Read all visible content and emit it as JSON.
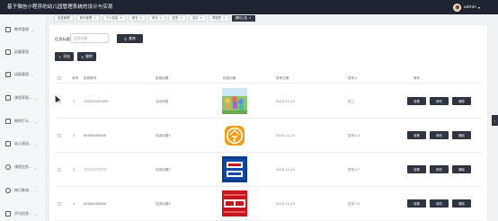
{
  "app": {
    "title": "基于微信小程序的幼儿园管理系统的设计与实现",
    "user_name": "admin"
  },
  "sidebar": {
    "items": [
      {
        "label": "教师管理",
        "icon": "teacher-icon"
      },
      {
        "label": "幼童管理",
        "icon": "child-icon"
      },
      {
        "label": "班级管理",
        "icon": "class-icon"
      },
      {
        "label": "课程表管...",
        "icon": "schedule-icon"
      },
      {
        "label": "教师打卡...",
        "icon": "clock-in-icon"
      },
      {
        "label": "幼儿接送...",
        "icon": "pickup-icon"
      },
      {
        "label": "课程信息...",
        "icon": "course-icon"
      },
      {
        "label": "每日食谱...",
        "icon": "menu-icon"
      },
      {
        "label": "资讯信息...",
        "icon": "news-icon"
      }
    ]
  },
  "tabs": [
    {
      "label": "信息管理"
    },
    {
      "label": "家长管理"
    },
    {
      "label": "个人信息"
    },
    {
      "label": "家长"
    },
    {
      "label": "家长"
    },
    {
      "label": "反馈"
    },
    {
      "label": "活动"
    },
    {
      "label": "课程表"
    },
    {
      "label": "通知公告",
      "active": true
    }
  ],
  "search": {
    "label": "信息标题",
    "placeholder": "信息标题",
    "button_label": "查询"
  },
  "toolbar": {
    "add_label": "添加",
    "delete_label": "删除"
  },
  "table": {
    "columns": {
      "index": "序号",
      "account": "信息账号",
      "title": "信息标题",
      "image": "信息封面",
      "date": "发布日期",
      "publisher": "发布人"
    },
    "operations_header": "操作",
    "rows": [
      {
        "index": "1",
        "account": "13325343365​9",
        "title": "活动采集",
        "date": "2023-12-14",
        "publisher": "张三",
        "image": "kids-playing"
      },
      {
        "index": "2",
        "account": "88888888888",
        "title": "信息标题3",
        "date": "2023-12-14",
        "publisher": "发布人3",
        "image": "today-orange-icon"
      },
      {
        "index": "3",
        "account": "77777777777",
        "title": "信息标题2",
        "date": "2023-12-14",
        "publisher": "发布人7",
        "image": "important-notice-blue"
      },
      {
        "index": "4",
        "account": "88888888888",
        "title": "信息标题5",
        "date": "2023-12-14",
        "publisher": "发布人4",
        "image": "important-announcement-red"
      }
    ],
    "row_actions": [
      "查看",
      "修改",
      "删除"
    ]
  },
  "colors": {
    "topbar": "#1f2430",
    "button": "#2e3440",
    "panel": "#ffffff"
  }
}
